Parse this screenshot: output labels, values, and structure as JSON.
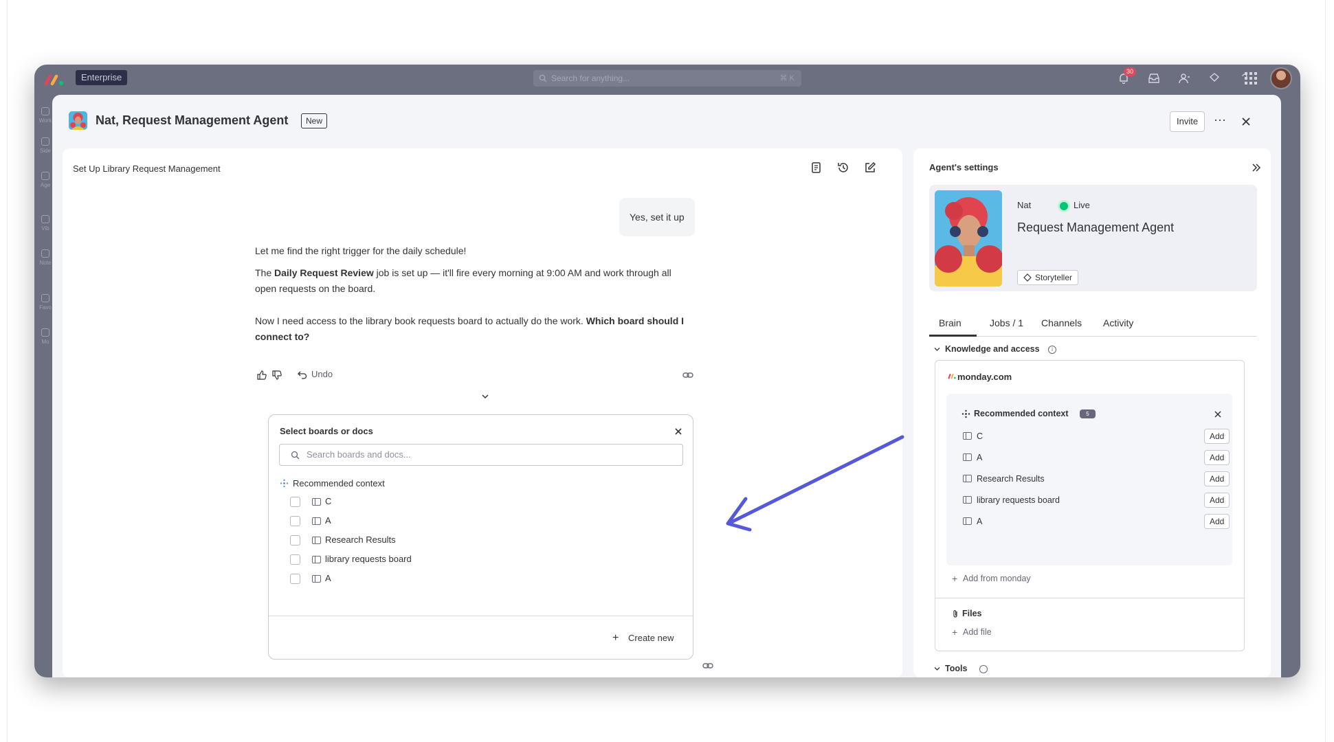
{
  "topbar": {
    "plan_badge": "Enterprise",
    "search_placeholder": "Search for anything...",
    "search_shortcut": "⌘ K",
    "notification_count": "30"
  },
  "left_rail": [
    "Work",
    "Side",
    "Age",
    "Vib",
    "Note",
    "Favo",
    "Mo"
  ],
  "modal": {
    "title": "Nat, Request Management Agent",
    "badge": "New",
    "invite_label": "Invite",
    "more_label": "···"
  },
  "chat": {
    "title": "Set Up Library Request Management",
    "user_message": "Yes, set it up",
    "agent_messages": {
      "m1": "Let me find the right trigger for the daily schedule!",
      "m2_pre": "The ",
      "m2_bold": "Daily Request Review",
      "m2_post": " job is set up — it'll fire every morning at 9:00 AM and work through all open requests on the board.",
      "m3_pre": "Now I need access to the library book requests board to actually do the work. ",
      "m3_bold": "Which board should I connect to?"
    },
    "undo_label": "Undo",
    "picker": {
      "title": "Select boards or docs",
      "search_placeholder": "Search boards and docs...",
      "section_label": "Recommended context",
      "items": [
        "C",
        "A",
        "Research Results",
        "library requests board",
        "A"
      ],
      "create_new_label": "Create new"
    }
  },
  "settings": {
    "title": "Agent's settings",
    "agent": {
      "name": "Nat",
      "status": "Live",
      "role": "Request Management Agent",
      "tag": "Storyteller"
    },
    "tabs": [
      "Brain",
      "Jobs / 1",
      "Channels",
      "Activity"
    ],
    "active_tab": "Brain",
    "knowledge": {
      "header": "Knowledge and access",
      "source": "monday.com",
      "recommended_title": "Recommended context",
      "recommended_count": "5",
      "items": [
        "C",
        "A",
        "Research Results",
        "library requests board",
        "A"
      ],
      "add_label": "Add",
      "add_from_label": "Add from monday",
      "files_label": "Files",
      "add_file_label": "Add file"
    },
    "tools_header": "Tools"
  },
  "colors": {
    "app_chrome": "#6c6f80",
    "annotation_arrow": "#5558d9",
    "live_status": "#00c875"
  }
}
